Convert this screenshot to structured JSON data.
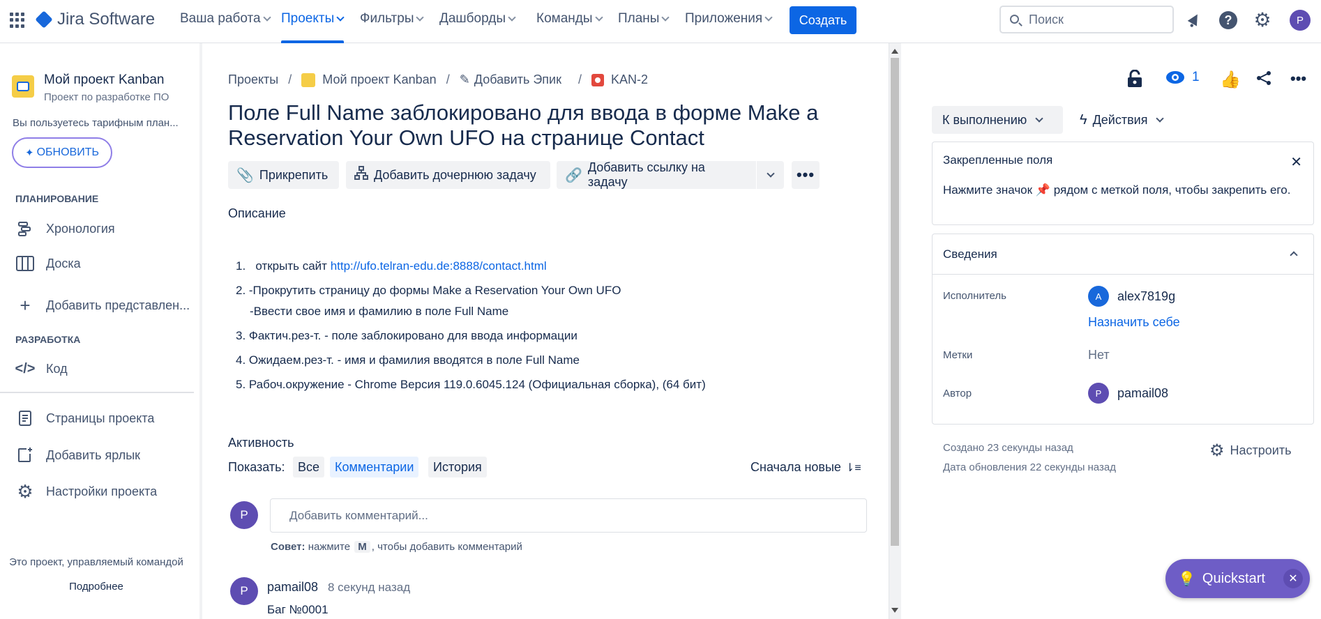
{
  "nav": {
    "brand": "Jira Software",
    "items": [
      {
        "label": "Ваша работа"
      },
      {
        "label": "Проекты"
      },
      {
        "label": "Фильтры"
      },
      {
        "label": "Дашборды"
      },
      {
        "label": "Команды"
      },
      {
        "label": "Планы"
      },
      {
        "label": "Приложения"
      }
    ],
    "active_index": 1,
    "create_label": "Создать",
    "search_placeholder": "Поиск",
    "user_initial": "P",
    "accent": "#0c66e4"
  },
  "sidebar": {
    "project_name": "Мой проект Kanban",
    "project_type": "Проект по разработке ПО",
    "plan_text": "Вы пользуетесь тарифным план...",
    "upgrade_label": "ОБНОВИТЬ",
    "planning_heading": "ПЛАНИРОВАНИЕ",
    "planning_items": [
      {
        "label": "Хронология",
        "icon": "timeline-icon"
      },
      {
        "label": "Доска",
        "icon": "board-icon"
      },
      {
        "label": "Добавить представлен...",
        "icon": "plus-icon"
      }
    ],
    "dev_heading": "РАЗРАБОТКА",
    "dev_items": [
      {
        "label": "Код",
        "icon": "code-icon"
      }
    ],
    "bottom_items": [
      {
        "label": "Страницы проекта",
        "icon": "pages-icon"
      },
      {
        "label": "Добавить ярлык",
        "icon": "add-shortcut-icon"
      },
      {
        "label": "Настройки проекта",
        "icon": "gear-icon"
      }
    ],
    "footer_text": "Это проект, управляемый командой",
    "footer_link": "Подробнее"
  },
  "issue": {
    "breadcrumb": [
      "Проекты",
      "Мой проект Kanban",
      "Добавить Эпик",
      "KAN-2"
    ],
    "title": "Поле Full Name заблокировано для ввода в форме Make a Reservation Your Own UFO на странице Contact",
    "actions": {
      "attach": "Прикрепить",
      "add_child": "Добавить дочернюю задачу",
      "link_issue": "Добавить ссылку на задачу"
    },
    "description_label": "Описание",
    "description": {
      "l1_num": "1.",
      "l1_text": "открыть сайт",
      "l1_link": "http://ufo.telran-edu.de:8888/contact.html",
      "l2": "2. -Прокрутить страницу до формы Make a Reservation Your Own UFO",
      "l2b": "-Ввести свое имя и фамилию в поле Full Name",
      "l3": "3. Фактич.рез-т. - поле заблокировано для ввода информации",
      "l4": "4. Ожидаем.рез-т. - имя и фамилия вводятся в поле Full Name",
      "l5": "5. Рабоч.окружение - Chrome Версия 119.0.6045.124 (Официальная сборка), (64 бит)"
    },
    "activity": {
      "label": "Активность",
      "show_label": "Показать:",
      "filters": [
        "Все",
        "Комментарии",
        "История"
      ],
      "selected_filter": 1,
      "sort_label": "Сначала новые",
      "comment_placeholder": "Добавить комментарий...",
      "tip_bold": "Совет:",
      "tip_pre": "нажмите",
      "tip_key": "M",
      "tip_post": ", чтобы добавить комментарий",
      "user_initial": "P",
      "comment_author": "pamail08",
      "comment_time": "8 секунд назад",
      "comment_text": "Баг №0001"
    }
  },
  "panel": {
    "watch_count": "1",
    "status_label": "К выполнению",
    "actions_label": "Действия",
    "pinned": {
      "title": "Закрепленные поля",
      "text_pre": "Нажмите значок",
      "text_post": "рядом с меткой поля, чтобы закрепить его."
    },
    "details": {
      "title": "Сведения",
      "assignee_label": "Исполнитель",
      "assignee_initial": "A",
      "assignee": "alex7819g",
      "assign_me": "Назначить себе",
      "labels_label": "Метки",
      "labels_value": "Нет",
      "reporter_label": "Автор",
      "reporter_initial": "P",
      "reporter": "pamail08"
    },
    "created": "Создано 23 секунды назад",
    "updated": "Дата обновления 22 секунды назад",
    "configure_label": "Настроить"
  },
  "quickstart": {
    "label": "Quickstart",
    "color": "#6e5dc6"
  }
}
